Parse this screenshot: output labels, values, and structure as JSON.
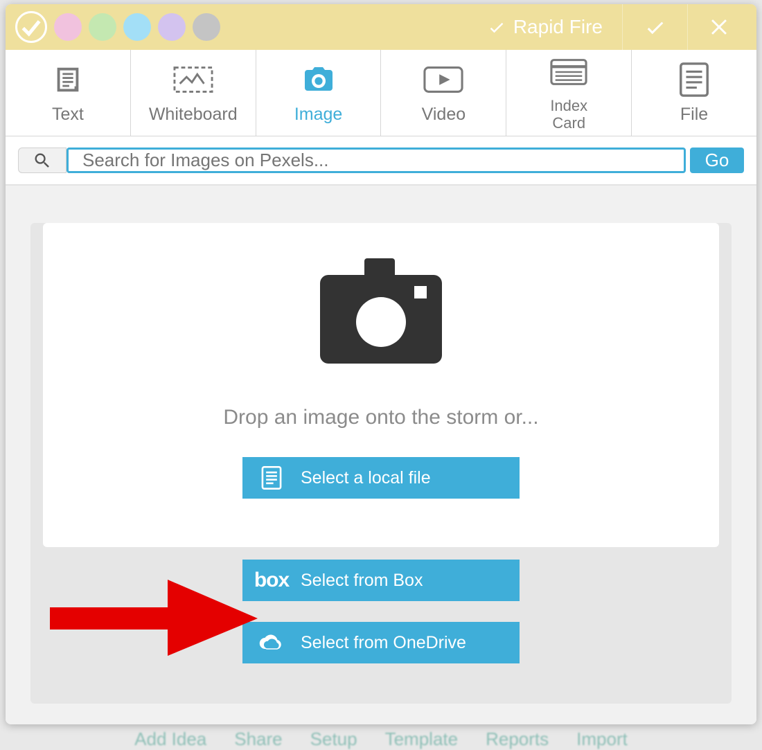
{
  "topbar": {
    "rapid_fire_label": "Rapid Fire"
  },
  "tabs": {
    "text": "Text",
    "whiteboard": "Whiteboard",
    "image": "Image",
    "video": "Video",
    "index_card": "Index\nCard",
    "index_card_line1": "Index",
    "index_card_line2": "Card",
    "file": "File",
    "active": "image"
  },
  "search": {
    "placeholder": "Search for Images on Pexels...",
    "go_label": "Go"
  },
  "drop": {
    "message": "Drop an image onto the storm or...",
    "local_label": "Select a local file",
    "box_label": "Select from Box",
    "onedrive_label": "Select from OneDrive",
    "box_logo_text": "box"
  },
  "background_footer": {
    "items": [
      "Add Idea",
      "Share",
      "Setup",
      "Template",
      "Reports",
      "Import"
    ]
  },
  "colors": {
    "accent": "#3faed9",
    "header_bg": "#efe09d",
    "arrow": "#e40000"
  }
}
